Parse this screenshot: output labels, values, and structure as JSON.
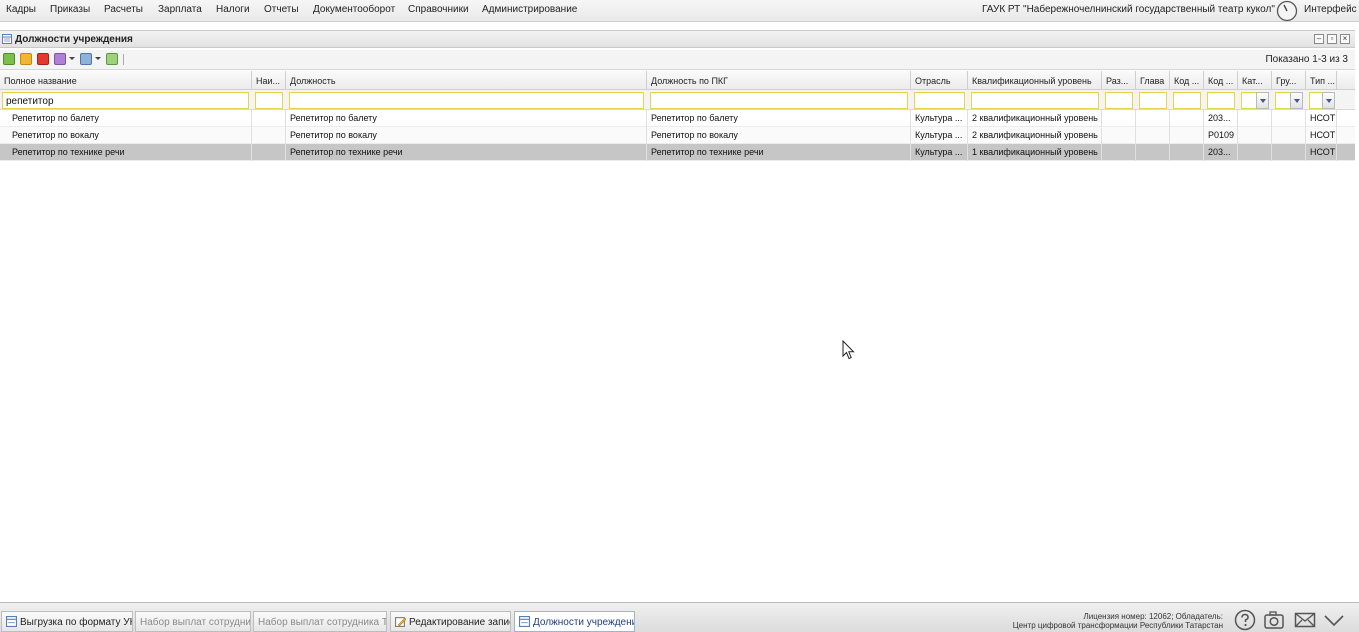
{
  "menu": {
    "items": [
      "Кадры",
      "Приказы",
      "Расчеты",
      "Зарплата",
      "Налоги",
      "Отчеты",
      "Документооборот",
      "Справочники",
      "Администрирование"
    ],
    "org_name": "ГАУК РТ \"Набережночелнинский государственный театр кукол\"",
    "interface_label": "Интерфейс"
  },
  "window": {
    "title": "Должности учреждения"
  },
  "toolbar": {
    "shown": "Показано 1-3 из 3"
  },
  "grid": {
    "columns": [
      "Полное название",
      "Наи...",
      "Должность",
      "Должность по ПКГ",
      "Отрасль",
      "Квалификационный уровень",
      "Раз...",
      "Глава",
      "Код ...",
      "Код ...",
      "Кат...",
      "Гру...",
      "Тип ..."
    ],
    "filter": {
      "full_name": "репетитор"
    },
    "rows": [
      [
        "Репетитор по балету",
        "",
        "Репетитор по балету",
        "Репетитор по балету",
        "Культура ...",
        "2 квалификационный уровень",
        "",
        "",
        "",
        "203...",
        "",
        "",
        "НСОТ"
      ],
      [
        "Репетитор по вокалу",
        "",
        "Репетитор по вокалу",
        "Репетитор по вокалу",
        "Культура ...",
        "2 квалификационный уровень",
        "",
        "",
        "",
        "Р0109",
        "",
        "",
        "НСОТ"
      ],
      [
        "Репетитор по технике речи",
        "",
        "Репетитор по технике речи",
        "Репетитор по технике речи",
        "Культура ...",
        "1 квалификационный уровень",
        "",
        "",
        "",
        "203...",
        "",
        "",
        "НСОТ"
      ]
    ],
    "selected_row": 2
  },
  "taskbar": {
    "tasks": [
      {
        "label": "Выгрузка по формату УК...",
        "state": "normal"
      },
      {
        "label": "Набор выплат сотрудника",
        "state": "disabled"
      },
      {
        "label": "Набор выплат сотрудника Те...",
        "state": "disabled"
      },
      {
        "label": "Редактирование записи",
        "state": "normal"
      },
      {
        "label": "Должности учреждения",
        "state": "active"
      }
    ],
    "license_line1": "Лицензия номер: 12062; Обладатель:",
    "license_line2": "Центр цифровой трансформации Республики Татарстан"
  },
  "colors": {
    "filter_border": "#e3d64a",
    "selected_row": "#c6c6c6",
    "active_task_text": "#22407a"
  },
  "icons": {
    "toolbar": [
      "add-icon",
      "edit-icon",
      "delete-icon",
      "settings-icon",
      "print-icon",
      "refresh-icon"
    ],
    "bottom": [
      "help-icon",
      "camera-icon",
      "mail-icon",
      "dropdown-icon"
    ]
  }
}
